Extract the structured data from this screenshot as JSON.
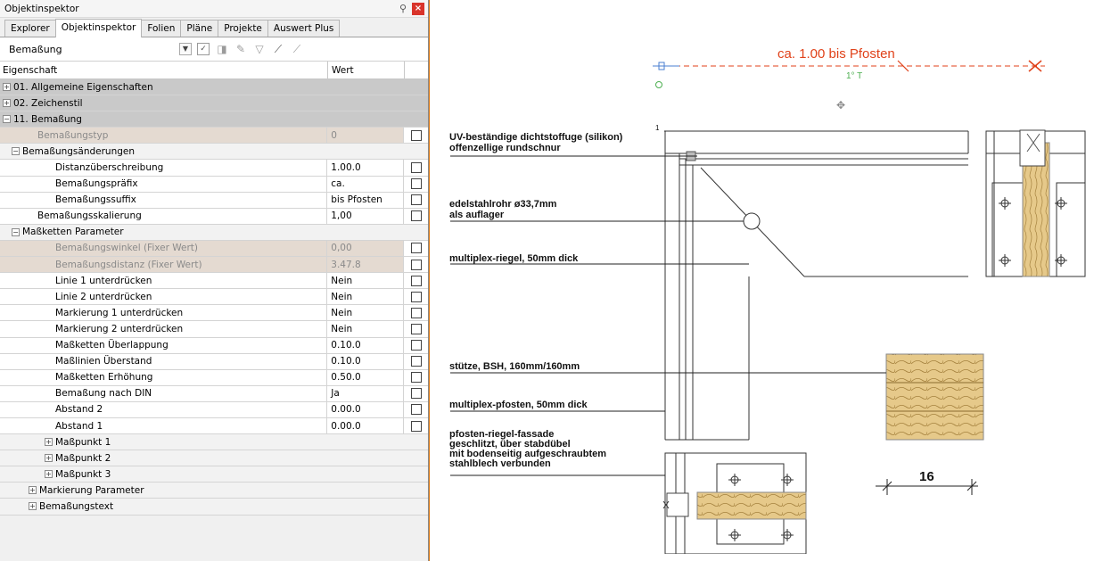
{
  "panel": {
    "title": "Objektinspektor",
    "tabs": [
      "Explorer",
      "Objektinspektor",
      "Folien",
      "Pläne",
      "Projekte",
      "Auswert Plus"
    ],
    "combo_value": "Bemaßung",
    "col_property": "Eigenschaft",
    "col_value": "Wert"
  },
  "rows": [
    {
      "label": "01. Allgemeine Eigenschaften",
      "value": "",
      "exp": "+"
    },
    {
      "label": "02. Zeichenstil",
      "value": "",
      "exp": "+"
    },
    {
      "label": "11. Bemaßung",
      "value": "",
      "exp": "−"
    },
    {
      "label": "Bemaßungstyp",
      "value": "0"
    },
    {
      "label": "Bemaßungsänderungen",
      "value": "",
      "exp": "−"
    },
    {
      "label": "Distanzüberschreibung",
      "value": "1.00.0"
    },
    {
      "label": "Bemaßungspräfix",
      "value": "ca."
    },
    {
      "label": "Bemaßungssuffix",
      "value": "bis Pfosten"
    },
    {
      "label": "Bemaßungsskalierung",
      "value": "1,00"
    },
    {
      "label": "Maßketten Parameter",
      "value": "",
      "exp": "−"
    },
    {
      "label": "Bemaßungswinkel (Fixer Wert)",
      "value": "0,00"
    },
    {
      "label": "Bemaßungsdistanz (Fixer Wert)",
      "value": "3.47.8"
    },
    {
      "label": "Linie 1 unterdrücken",
      "value": "Nein"
    },
    {
      "label": "Linie 2 unterdrücken",
      "value": "Nein"
    },
    {
      "label": "Markierung 1 unterdrücken",
      "value": "Nein"
    },
    {
      "label": "Markierung 2 unterdrücken",
      "value": "Nein"
    },
    {
      "label": "Maßketten Überlappung",
      "value": "0.10.0"
    },
    {
      "label": "Maßlinien Überstand",
      "value": "0.10.0"
    },
    {
      "label": "Maßketten Erhöhung",
      "value": "0.50.0"
    },
    {
      "label": "Bemaßung nach DIN",
      "value": "Ja"
    },
    {
      "label": "Abstand 2",
      "value": "0.00.0"
    },
    {
      "label": "Abstand 1",
      "value": "0.00.0"
    },
    {
      "label": "Maßpunkt 1",
      "value": "",
      "exp": "+"
    },
    {
      "label": "Maßpunkt 2",
      "value": "",
      "exp": "+"
    },
    {
      "label": "Maßpunkt 3",
      "value": "",
      "exp": "+"
    },
    {
      "label": "Markierung Parameter",
      "value": "",
      "exp": "+"
    },
    {
      "label": "Bemaßungstext",
      "value": "",
      "exp": "+"
    }
  ],
  "drawing": {
    "dimension_text": "ca. 1.00 bis Pfosten",
    "small_label": "1",
    "labels": [
      "UV-beständige dichtstoffuge (silikon)",
      "offenzellige rundschnur",
      "edelstahlrohr ø33,7mm",
      "als auflager",
      "multiplex-riegel, 50mm dick",
      "stütze, BSH, 160mm/160mm",
      "multiplex-pfosten, 50mm dick",
      "pfosten-riegel-fassade",
      "geschlitzt, über stabdübel",
      "mit bodenseitig aufgeschraubtem",
      "stahlblech verbunden"
    ],
    "dim_16": "16",
    "accent_color": "#e07b14",
    "dim_color": "#e0421a"
  }
}
